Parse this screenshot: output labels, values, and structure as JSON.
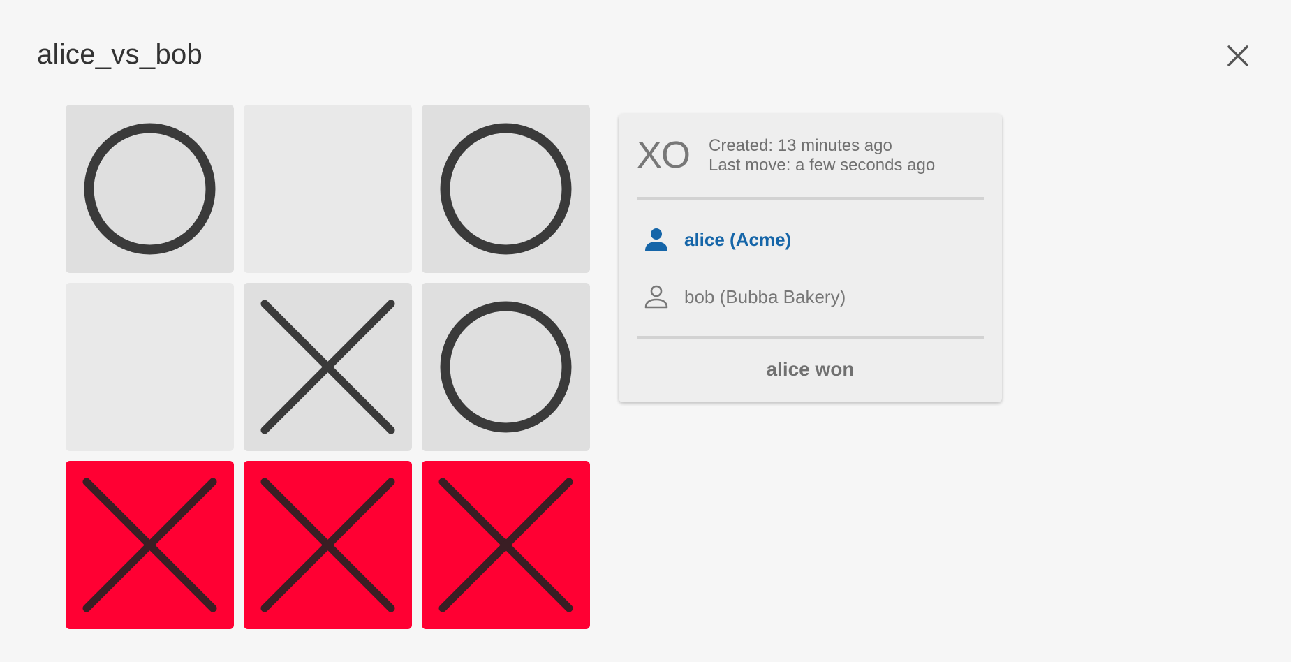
{
  "dialog": {
    "title": "alice_vs_bob",
    "close_icon": "close-icon"
  },
  "board": {
    "cells": [
      "O",
      "",
      "O",
      "",
      "X",
      "O",
      "X",
      "X",
      "X"
    ],
    "winning_cells": [
      6,
      7,
      8
    ],
    "colors": {
      "filled_bg": "#dfdfdf",
      "empty_bg": "#e9e9e9",
      "win_bg": "#ff0033",
      "mark": "#3a3a3a",
      "win_mark": "#3a1e24"
    }
  },
  "info": {
    "logo": "XO",
    "created": "Created: 13 minutes ago",
    "last_move": "Last move: a few seconds ago",
    "players": [
      {
        "label": "alice (Acme)",
        "icon": "person-filled-icon",
        "active": true
      },
      {
        "label": "bob (Bubba Bakery)",
        "icon": "person-outline-icon",
        "active": false
      }
    ],
    "result": "alice won",
    "colors": {
      "active_player": "#1565a8",
      "inactive_player": "#777777"
    }
  }
}
